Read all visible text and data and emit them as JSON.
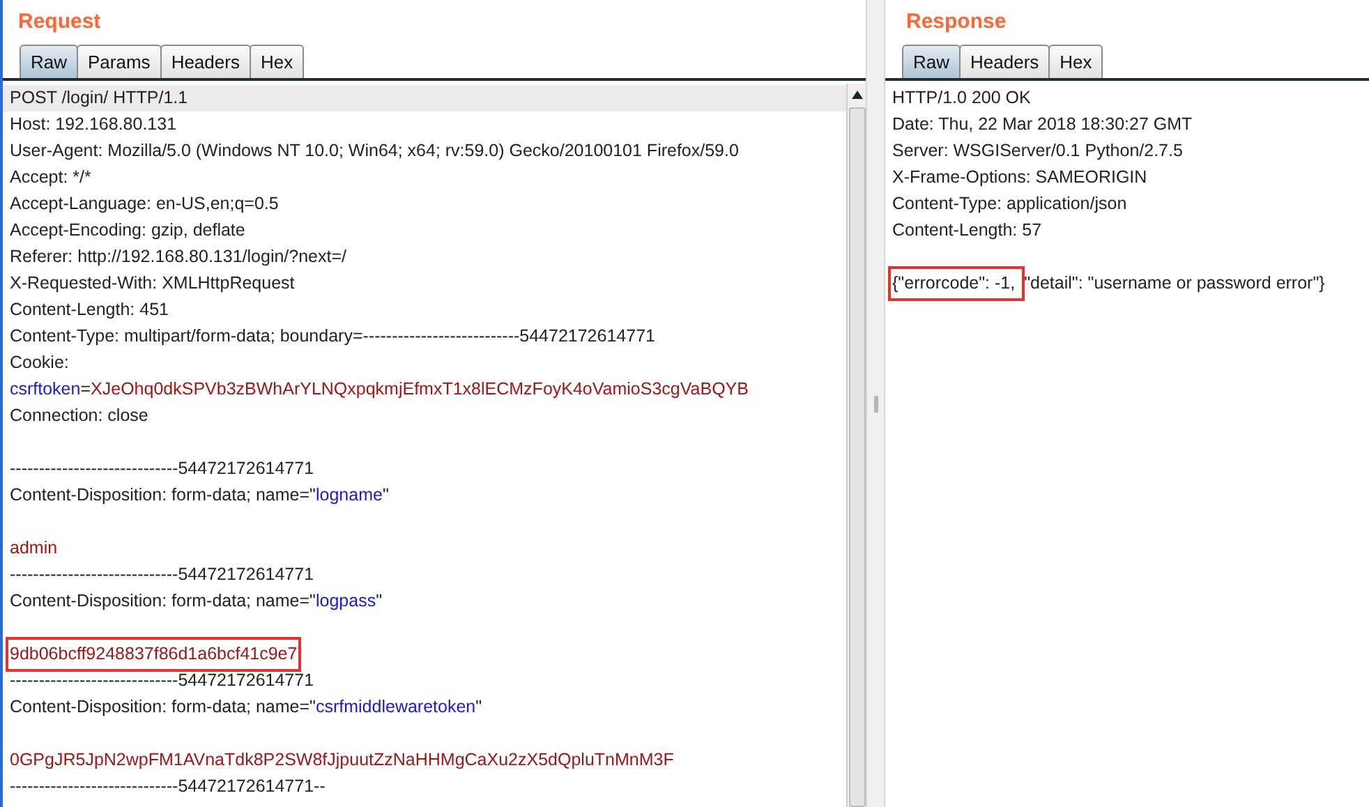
{
  "request": {
    "title": "Request",
    "tabs": [
      {
        "label": "Raw",
        "selected": true
      },
      {
        "label": "Params",
        "selected": false
      },
      {
        "label": "Headers",
        "selected": false
      },
      {
        "label": "Hex",
        "selected": false
      }
    ],
    "lines": [
      {
        "kind": "text",
        "current": true,
        "segments": [
          {
            "kind": "plain",
            "text": "POST /login/ HTTP/1.1"
          }
        ]
      },
      {
        "kind": "text",
        "current": false,
        "segments": [
          {
            "kind": "plain",
            "text": "Host: 192.168.80.131"
          }
        ]
      },
      {
        "kind": "text",
        "current": false,
        "segments": [
          {
            "kind": "plain",
            "text": "User-Agent: Mozilla/5.0 (Windows NT 10.0; Win64; x64; rv:59.0) Gecko/20100101 Firefox/59.0"
          }
        ]
      },
      {
        "kind": "text",
        "current": false,
        "segments": [
          {
            "kind": "plain",
            "text": "Accept: */*"
          }
        ]
      },
      {
        "kind": "text",
        "current": false,
        "segments": [
          {
            "kind": "plain",
            "text": "Accept-Language: en-US,en;q=0.5"
          }
        ]
      },
      {
        "kind": "text",
        "current": false,
        "segments": [
          {
            "kind": "plain",
            "text": "Accept-Encoding: gzip, deflate"
          }
        ]
      },
      {
        "kind": "text",
        "current": false,
        "segments": [
          {
            "kind": "plain",
            "text": "Referer: http://192.168.80.131/login/?next=/"
          }
        ]
      },
      {
        "kind": "text",
        "current": false,
        "segments": [
          {
            "kind": "plain",
            "text": "X-Requested-With: XMLHttpRequest"
          }
        ]
      },
      {
        "kind": "text",
        "current": false,
        "segments": [
          {
            "kind": "plain",
            "text": "Content-Length: 451"
          }
        ]
      },
      {
        "kind": "text",
        "current": false,
        "segments": [
          {
            "kind": "plain",
            "text": "Content-Type: multipart/form-data; boundary=---------------------------54472172614771"
          }
        ]
      },
      {
        "kind": "text",
        "current": false,
        "segments": [
          {
            "kind": "plain",
            "text": "Cookie:"
          }
        ]
      },
      {
        "kind": "text",
        "current": false,
        "segments": [
          {
            "kind": "name",
            "text": "csrftoken"
          },
          {
            "kind": "plain",
            "text": "="
          },
          {
            "kind": "value",
            "text": "XJeOhq0dkSPVb3zBWhArYLNQxpqkmjEfmxT1x8lECMzFoyK4oVamioS3cgVaBQYB"
          }
        ]
      },
      {
        "kind": "text",
        "current": false,
        "segments": [
          {
            "kind": "plain",
            "text": "Connection: close"
          }
        ]
      },
      {
        "kind": "blank"
      },
      {
        "kind": "text",
        "current": false,
        "segments": [
          {
            "kind": "plain",
            "text": "-----------------------------54472172614771"
          }
        ]
      },
      {
        "kind": "text",
        "current": false,
        "segments": [
          {
            "kind": "plain",
            "text": "Content-Disposition: form-data; name=\""
          },
          {
            "kind": "name",
            "text": "logname"
          },
          {
            "kind": "plain",
            "text": "\""
          }
        ]
      },
      {
        "kind": "blank"
      },
      {
        "kind": "text",
        "current": false,
        "segments": [
          {
            "kind": "value",
            "text": "admin"
          }
        ]
      },
      {
        "kind": "text",
        "current": false,
        "segments": [
          {
            "kind": "plain",
            "text": "-----------------------------54472172614771"
          }
        ]
      },
      {
        "kind": "text",
        "current": false,
        "segments": [
          {
            "kind": "plain",
            "text": "Content-Disposition: form-data; name=\""
          },
          {
            "kind": "name",
            "text": "logpass"
          },
          {
            "kind": "plain",
            "text": "\""
          }
        ]
      },
      {
        "kind": "blank"
      },
      {
        "kind": "text",
        "current": false,
        "segments": [
          {
            "kind": "value",
            "text": "9db06bcff9248837f86d1a6bcf41c9e7",
            "boxed": true
          }
        ]
      },
      {
        "kind": "text",
        "current": false,
        "segments": [
          {
            "kind": "plain",
            "text": "-----------------------------54472172614771"
          }
        ]
      },
      {
        "kind": "text",
        "current": false,
        "segments": [
          {
            "kind": "plain",
            "text": "Content-Disposition: form-data; name=\""
          },
          {
            "kind": "name",
            "text": "csrfmiddlewaretoken"
          },
          {
            "kind": "plain",
            "text": "\""
          }
        ]
      },
      {
        "kind": "blank"
      },
      {
        "kind": "text",
        "current": false,
        "segments": [
          {
            "kind": "value",
            "text": "0GPgJR5JpN2wpFM1AVnaTdk8P2SW8fJjpuutZzNaHHMgCaXu2zX5dQpluTnMnM3F"
          }
        ]
      },
      {
        "kind": "text",
        "current": false,
        "segments": [
          {
            "kind": "plain",
            "text": "-----------------------------54472172614771--"
          }
        ]
      }
    ]
  },
  "response": {
    "title": "Response",
    "tabs": [
      {
        "label": "Raw",
        "selected": true
      },
      {
        "label": "Headers",
        "selected": false
      },
      {
        "label": "Hex",
        "selected": false
      }
    ],
    "lines": [
      {
        "kind": "text",
        "current": false,
        "segments": [
          {
            "kind": "plain",
            "text": "HTTP/1.0 200 OK"
          }
        ]
      },
      {
        "kind": "text",
        "current": false,
        "segments": [
          {
            "kind": "plain",
            "text": "Date: Thu, 22 Mar 2018 18:30:27 GMT"
          }
        ]
      },
      {
        "kind": "text",
        "current": false,
        "segments": [
          {
            "kind": "plain",
            "text": "Server: WSGIServer/0.1 Python/2.7.5"
          }
        ]
      },
      {
        "kind": "text",
        "current": false,
        "segments": [
          {
            "kind": "plain",
            "text": "X-Frame-Options: SAMEORIGIN"
          }
        ]
      },
      {
        "kind": "text",
        "current": false,
        "segments": [
          {
            "kind": "plain",
            "text": "Content-Type: application/json"
          }
        ]
      },
      {
        "kind": "text",
        "current": false,
        "segments": [
          {
            "kind": "plain",
            "text": "Content-Length: 57"
          }
        ]
      },
      {
        "kind": "blank"
      },
      {
        "kind": "text",
        "current": false,
        "segments": [
          {
            "kind": "plain",
            "text": "{\"errorcode\": -1, ",
            "boxed": true
          },
          {
            "kind": "plain",
            "text": "\"detail\": \"username or password error\"}"
          }
        ]
      }
    ]
  }
}
